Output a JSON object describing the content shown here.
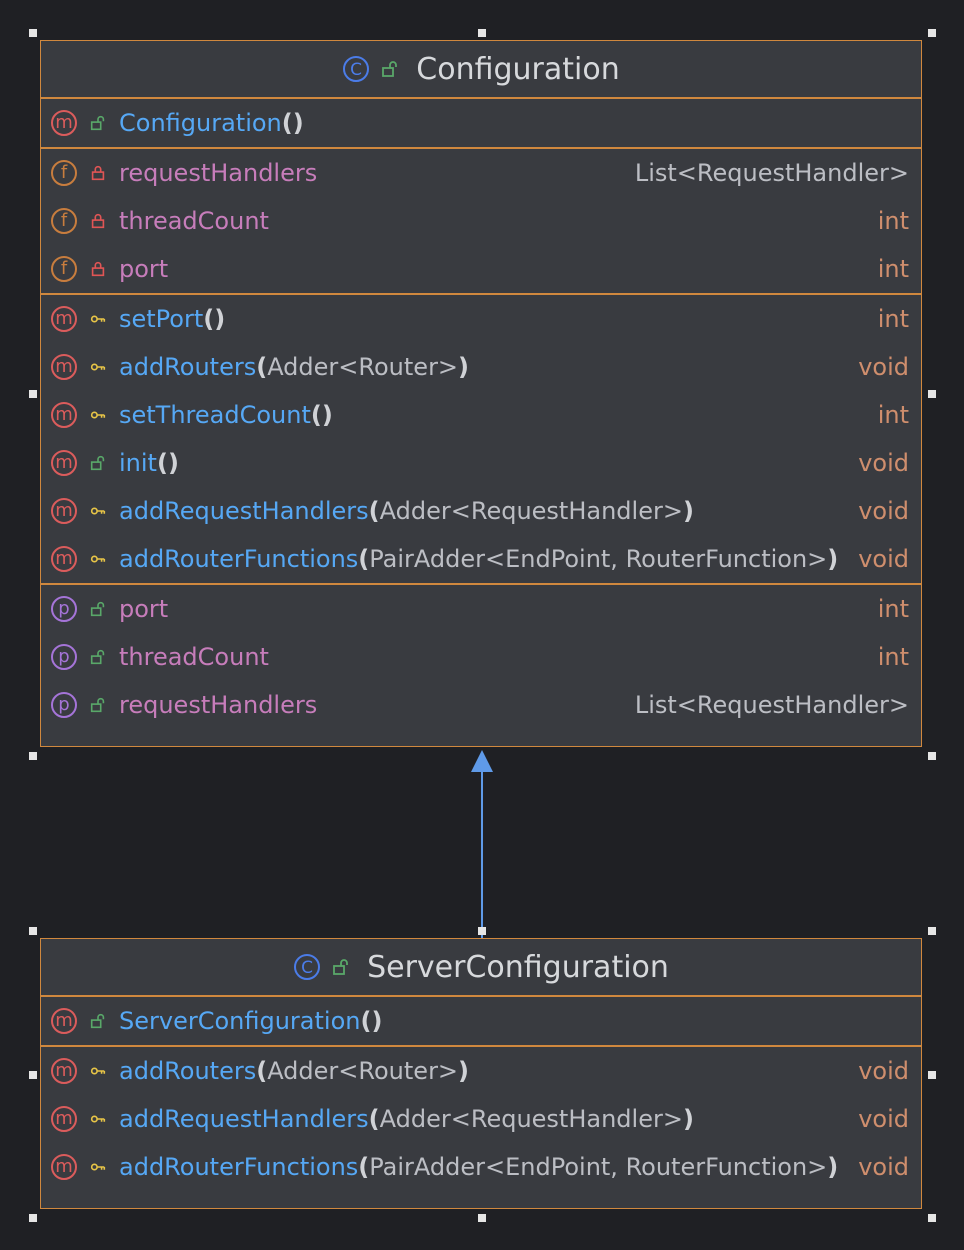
{
  "classes": [
    {
      "name": "Configuration",
      "constructor": {
        "name": "Configuration",
        "params": ""
      },
      "fields": [
        {
          "name": "requestHandlers",
          "type": "List<RequestHandler>"
        },
        {
          "name": "threadCount",
          "type": "int"
        },
        {
          "name": "port",
          "type": "int"
        }
      ],
      "methods": [
        {
          "name": "setPort",
          "params": "",
          "return": "int"
        },
        {
          "name": "addRouters",
          "params": "Adder<Router>",
          "return": "void"
        },
        {
          "name": "setThreadCount",
          "params": "",
          "return": "int"
        },
        {
          "name": "init",
          "params": "",
          "return": "void"
        },
        {
          "name": "addRequestHandlers",
          "params": "Adder<RequestHandler>",
          "return": "void"
        },
        {
          "name": "addRouterFunctions",
          "params": "PairAdder<EndPoint, RouterFunction>",
          "return": "void"
        }
      ],
      "properties": [
        {
          "name": "port",
          "type": "int"
        },
        {
          "name": "threadCount",
          "type": "int"
        },
        {
          "name": "requestHandlers",
          "type": "List<RequestHandler>"
        }
      ]
    },
    {
      "name": "ServerConfiguration",
      "constructor": {
        "name": "ServerConfiguration",
        "params": ""
      },
      "methods": [
        {
          "name": "addRouters",
          "params": "Adder<Router>",
          "return": "void"
        },
        {
          "name": "addRequestHandlers",
          "params": "Adder<RequestHandler>",
          "return": "void"
        },
        {
          "name": "addRouterFunctions",
          "params": "PairAdder<EndPoint, RouterFunction>",
          "return": "void"
        }
      ]
    }
  ],
  "glyphs": {
    "paren_open": "(",
    "paren_close": ")",
    "method_kind": "m",
    "field_kind": "f",
    "property_kind": "p"
  },
  "colors": {
    "background": "#1f2024",
    "class_fill": "#393b40",
    "class_border": "#d0883e",
    "method_name": "#56a8f5",
    "field_name": "#c77dbb",
    "primitive_type": "#cf8e6d",
    "inheritance_arrow": "#5f9ae8"
  },
  "icons": {
    "class_kind": "class-c-icon",
    "public": "unlocked-padlock-icon",
    "private": "locked-padlock-icon",
    "protected": "key-icon"
  }
}
